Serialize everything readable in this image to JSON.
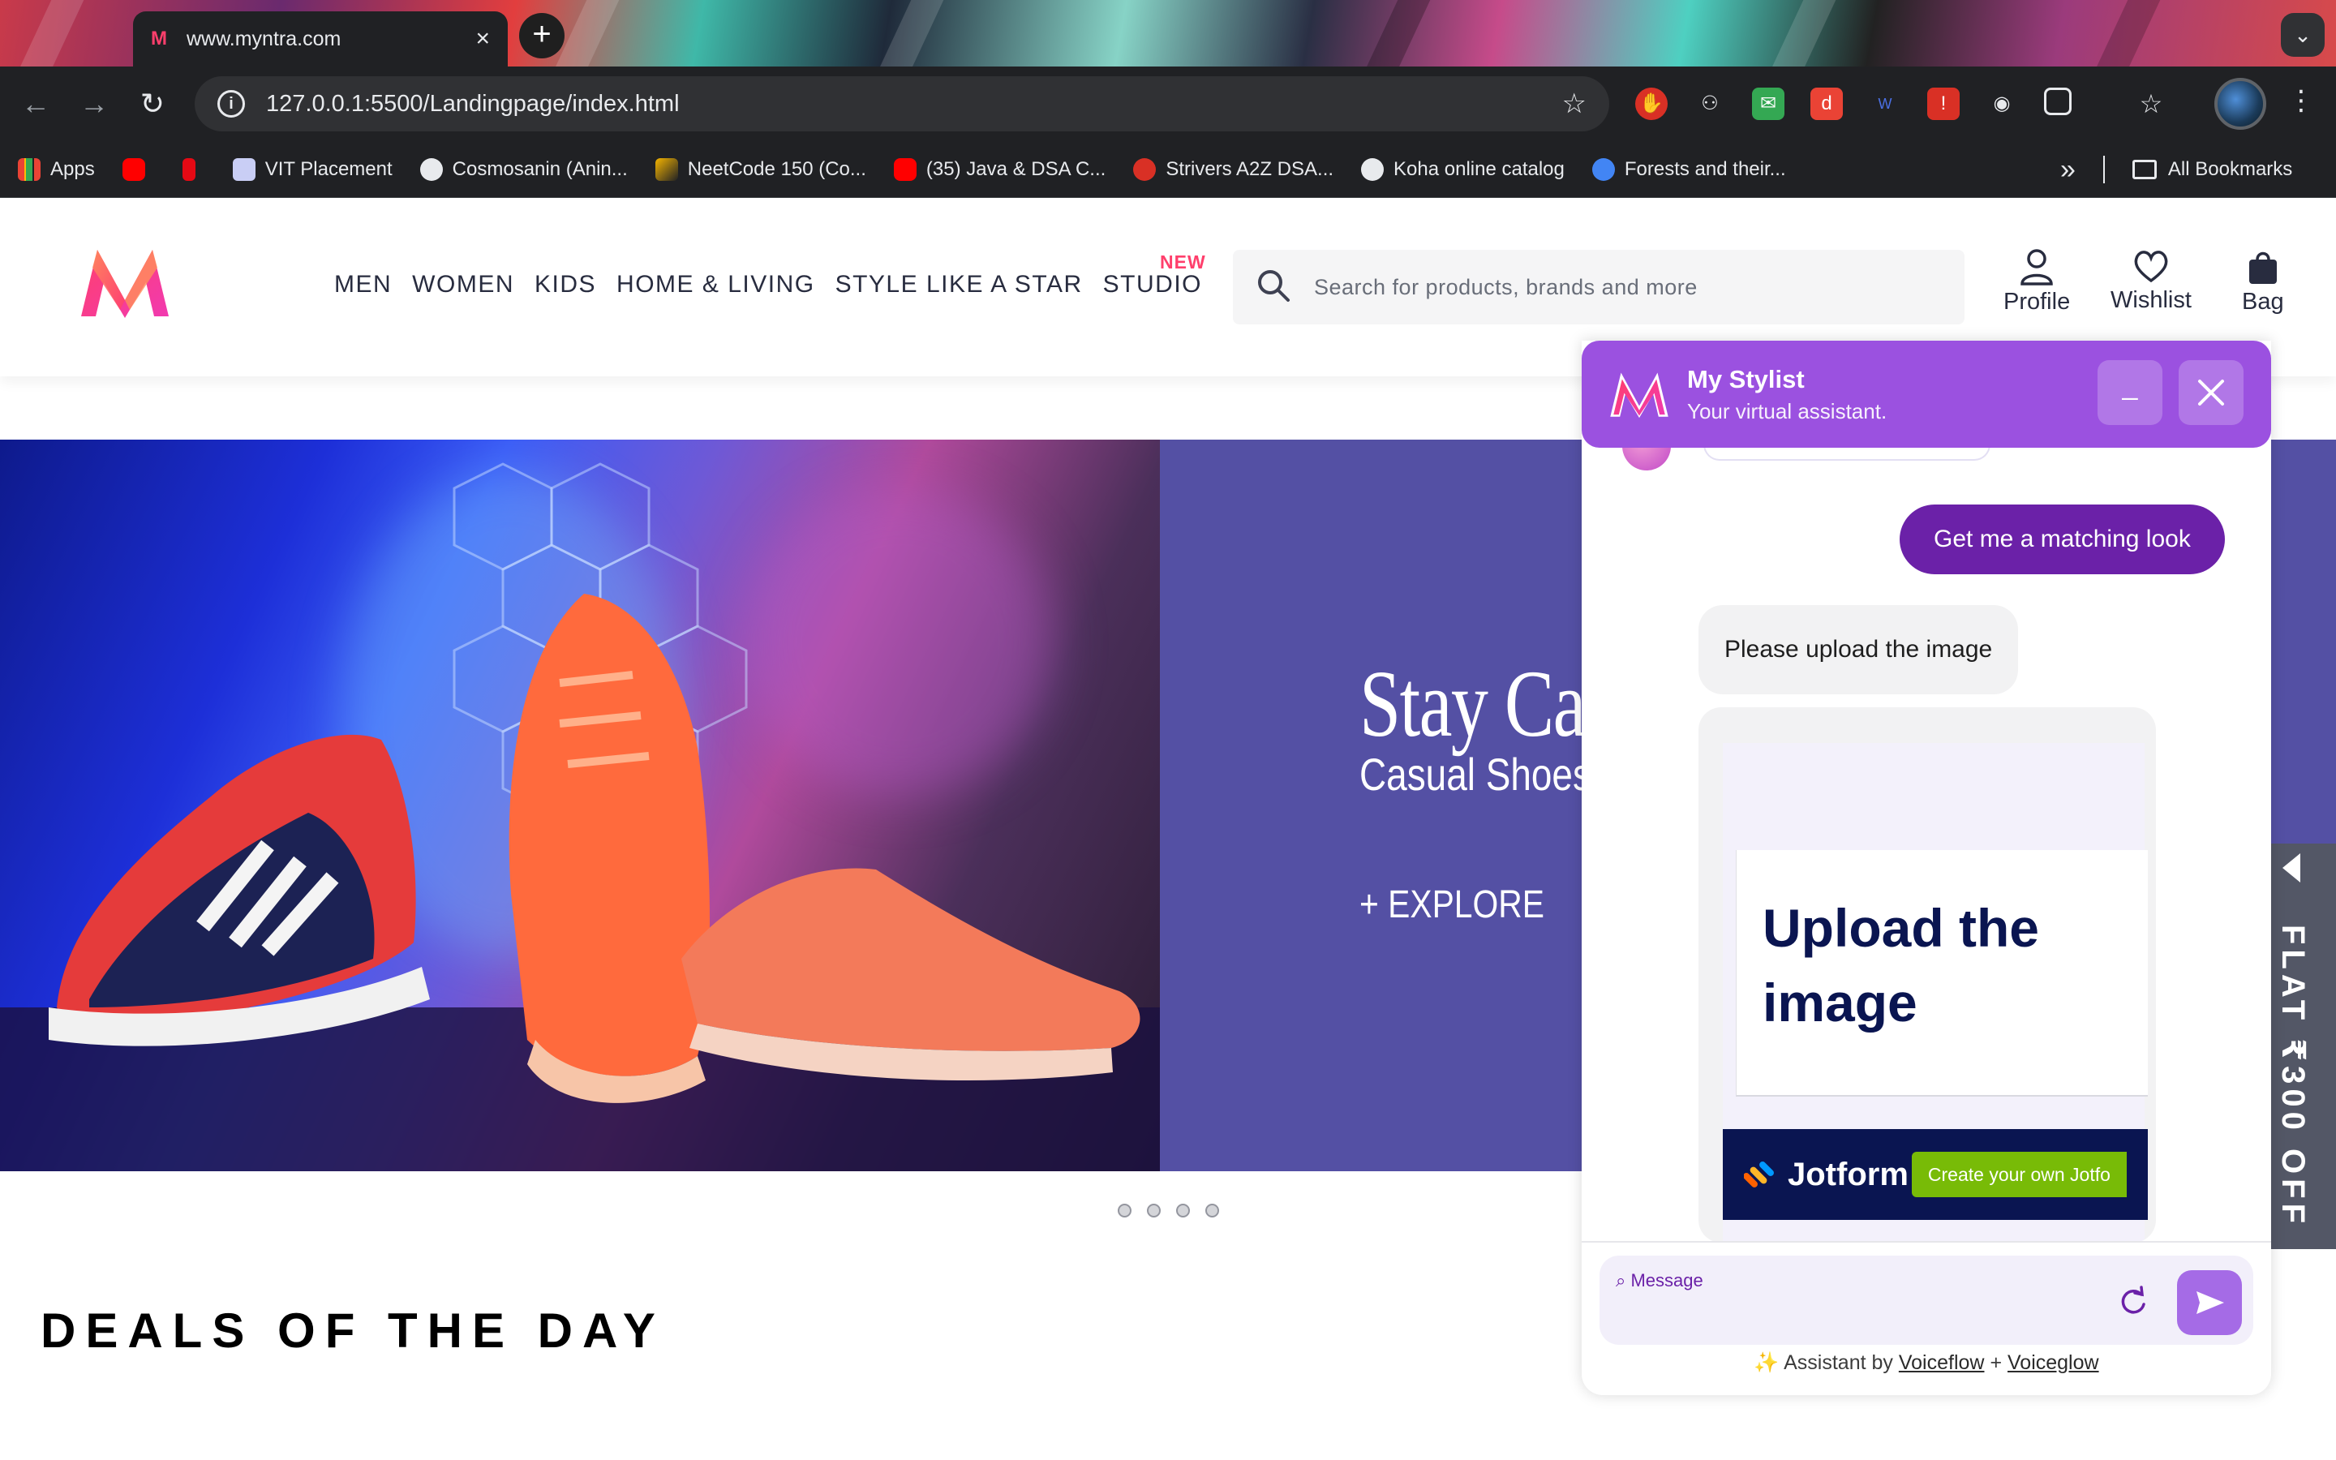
{
  "browser": {
    "tab_title": "www.myntra.com",
    "tab_close": "×",
    "new_tab": "+",
    "tab_menu": "⌄",
    "url": "127.0.0.1:5500/Landingpage/index.html",
    "bookmarks": [
      {
        "label": "Apps",
        "color": "#ea4335"
      },
      {
        "label": "",
        "color": "#ff0000"
      },
      {
        "label": "",
        "color": "#e50914"
      },
      {
        "label": "VIT Placement",
        "color": "#6d7bd6"
      },
      {
        "label": "Cosmosanin (Anin...",
        "color": "#e8eaed"
      },
      {
        "label": "NeetCode 150 (Co...",
        "color": "#f4b400"
      },
      {
        "label": "(35) Java & DSA C...",
        "color": "#ff0000"
      },
      {
        "label": "Strivers A2Z DSA...",
        "color": "#d93025"
      },
      {
        "label": "Koha online catalog",
        "color": "#e8eaed"
      },
      {
        "label": "Forests and their...",
        "color": "#4285f4"
      }
    ],
    "bookmarks_more": "»",
    "all_bookmarks": "All Bookmarks"
  },
  "header": {
    "nav": [
      "MEN",
      "WOMEN",
      "KIDS",
      "HOME & LIVING",
      "STYLE LIKE A STAR",
      "STUDIO"
    ],
    "new_badge": "NEW",
    "search_placeholder": "Search for products, brands and more",
    "actions": {
      "profile": "Profile",
      "wishlist": "Wishlist",
      "bag": "Bag"
    },
    "brand_colors": [
      "#ff3f6c",
      "#f13ab1",
      "#ff905a"
    ]
  },
  "banner": {
    "title": "Stay Ca",
    "subtitle": "Casual Shoes",
    "cta": "+ EXPLORE",
    "background": "#5450a4"
  },
  "carousel": {
    "dots": 4
  },
  "deals": {
    "title": "DEALS OF THE DAY"
  },
  "offer_tab": {
    "text": "FLAT ₹300 OFF"
  },
  "chat": {
    "title": "My Stylist",
    "subtitle": "Your virtual assistant.",
    "minimize": "_",
    "accent": "#9b51e0",
    "user_message": "Get me a matching look",
    "bot_message": "Please upload the image",
    "form_heading": "Upload the image",
    "jotform_brand": "Jotform",
    "jotform_cta": "Create your own Jotfo",
    "composer_placeholder": "Message",
    "credit_prefix": "Assistant by",
    "credit_link1": "Voiceflow",
    "credit_plus": "+",
    "credit_link2": "Voiceglow"
  }
}
